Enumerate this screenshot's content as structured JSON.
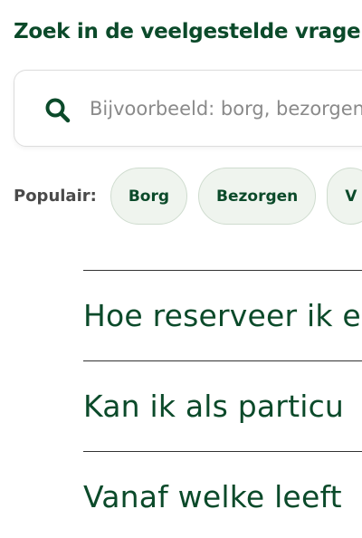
{
  "heading": "Zoek in de veelgestelde vragen",
  "search": {
    "placeholder": "Bijvoorbeeld: borg, bezorgen"
  },
  "popular": {
    "label": "Populair:",
    "chips": [
      "Borg",
      "Bezorgen",
      "V"
    ]
  },
  "faq": [
    {
      "question": "Hoe reserveer ik e"
    },
    {
      "question": "Kan ik als particu"
    },
    {
      "question": "Vanaf welke leeft"
    }
  ],
  "colors": {
    "brand_green": "#0b4a2a",
    "chip_bg": "#eff4ee",
    "chip_border": "#cfdccf"
  }
}
